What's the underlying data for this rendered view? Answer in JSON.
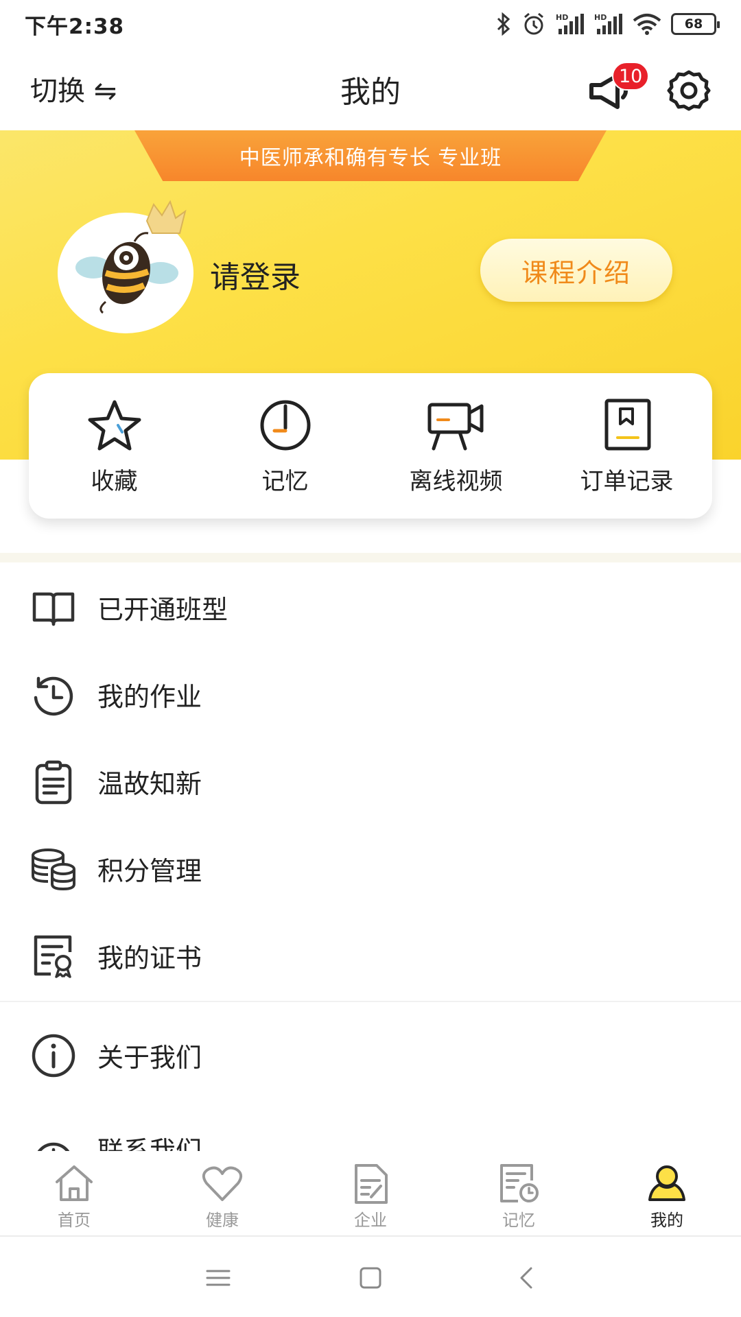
{
  "status": {
    "time": "下午2:38",
    "battery": "68"
  },
  "header": {
    "switch_label": "切换 ⇋",
    "title": "我的",
    "notice_count": "10"
  },
  "banner": {
    "ribbon_text": "中医师承和确有专长 专业班",
    "login_text": "请登录",
    "course_button": "课程介绍"
  },
  "quick": [
    {
      "label": "收藏",
      "icon": "star-icon"
    },
    {
      "label": "记忆",
      "icon": "clock-icon"
    },
    {
      "label": "离线视频",
      "icon": "video-camera-icon"
    },
    {
      "label": "订单记录",
      "icon": "bookmark-icon"
    }
  ],
  "menu": [
    {
      "label": "已开通班型",
      "icon": "open-book-icon"
    },
    {
      "label": "我的作业",
      "icon": "history-icon"
    },
    {
      "label": "温故知新",
      "icon": "clipboard-icon"
    },
    {
      "label": "积分管理",
      "icon": "coins-icon"
    },
    {
      "label": "我的证书",
      "icon": "certificate-icon"
    },
    {
      "label": "关于我们",
      "icon": "info-icon"
    },
    {
      "label": "联系我们",
      "icon": "contact-icon"
    }
  ],
  "tabs": [
    {
      "label": "首页",
      "icon": "home-icon",
      "active": false
    },
    {
      "label": "健康",
      "icon": "heart-icon",
      "active": false
    },
    {
      "label": "企业",
      "icon": "document-icon",
      "active": false
    },
    {
      "label": "记忆",
      "icon": "memory-icon",
      "active": false
    },
    {
      "label": "我的",
      "icon": "user-icon",
      "active": true
    }
  ],
  "colors": {
    "accent_yellow": "#fde047",
    "ribbon_orange": "#f7862b",
    "button_text": "#f08a1a",
    "badge_red": "#e8202a"
  }
}
